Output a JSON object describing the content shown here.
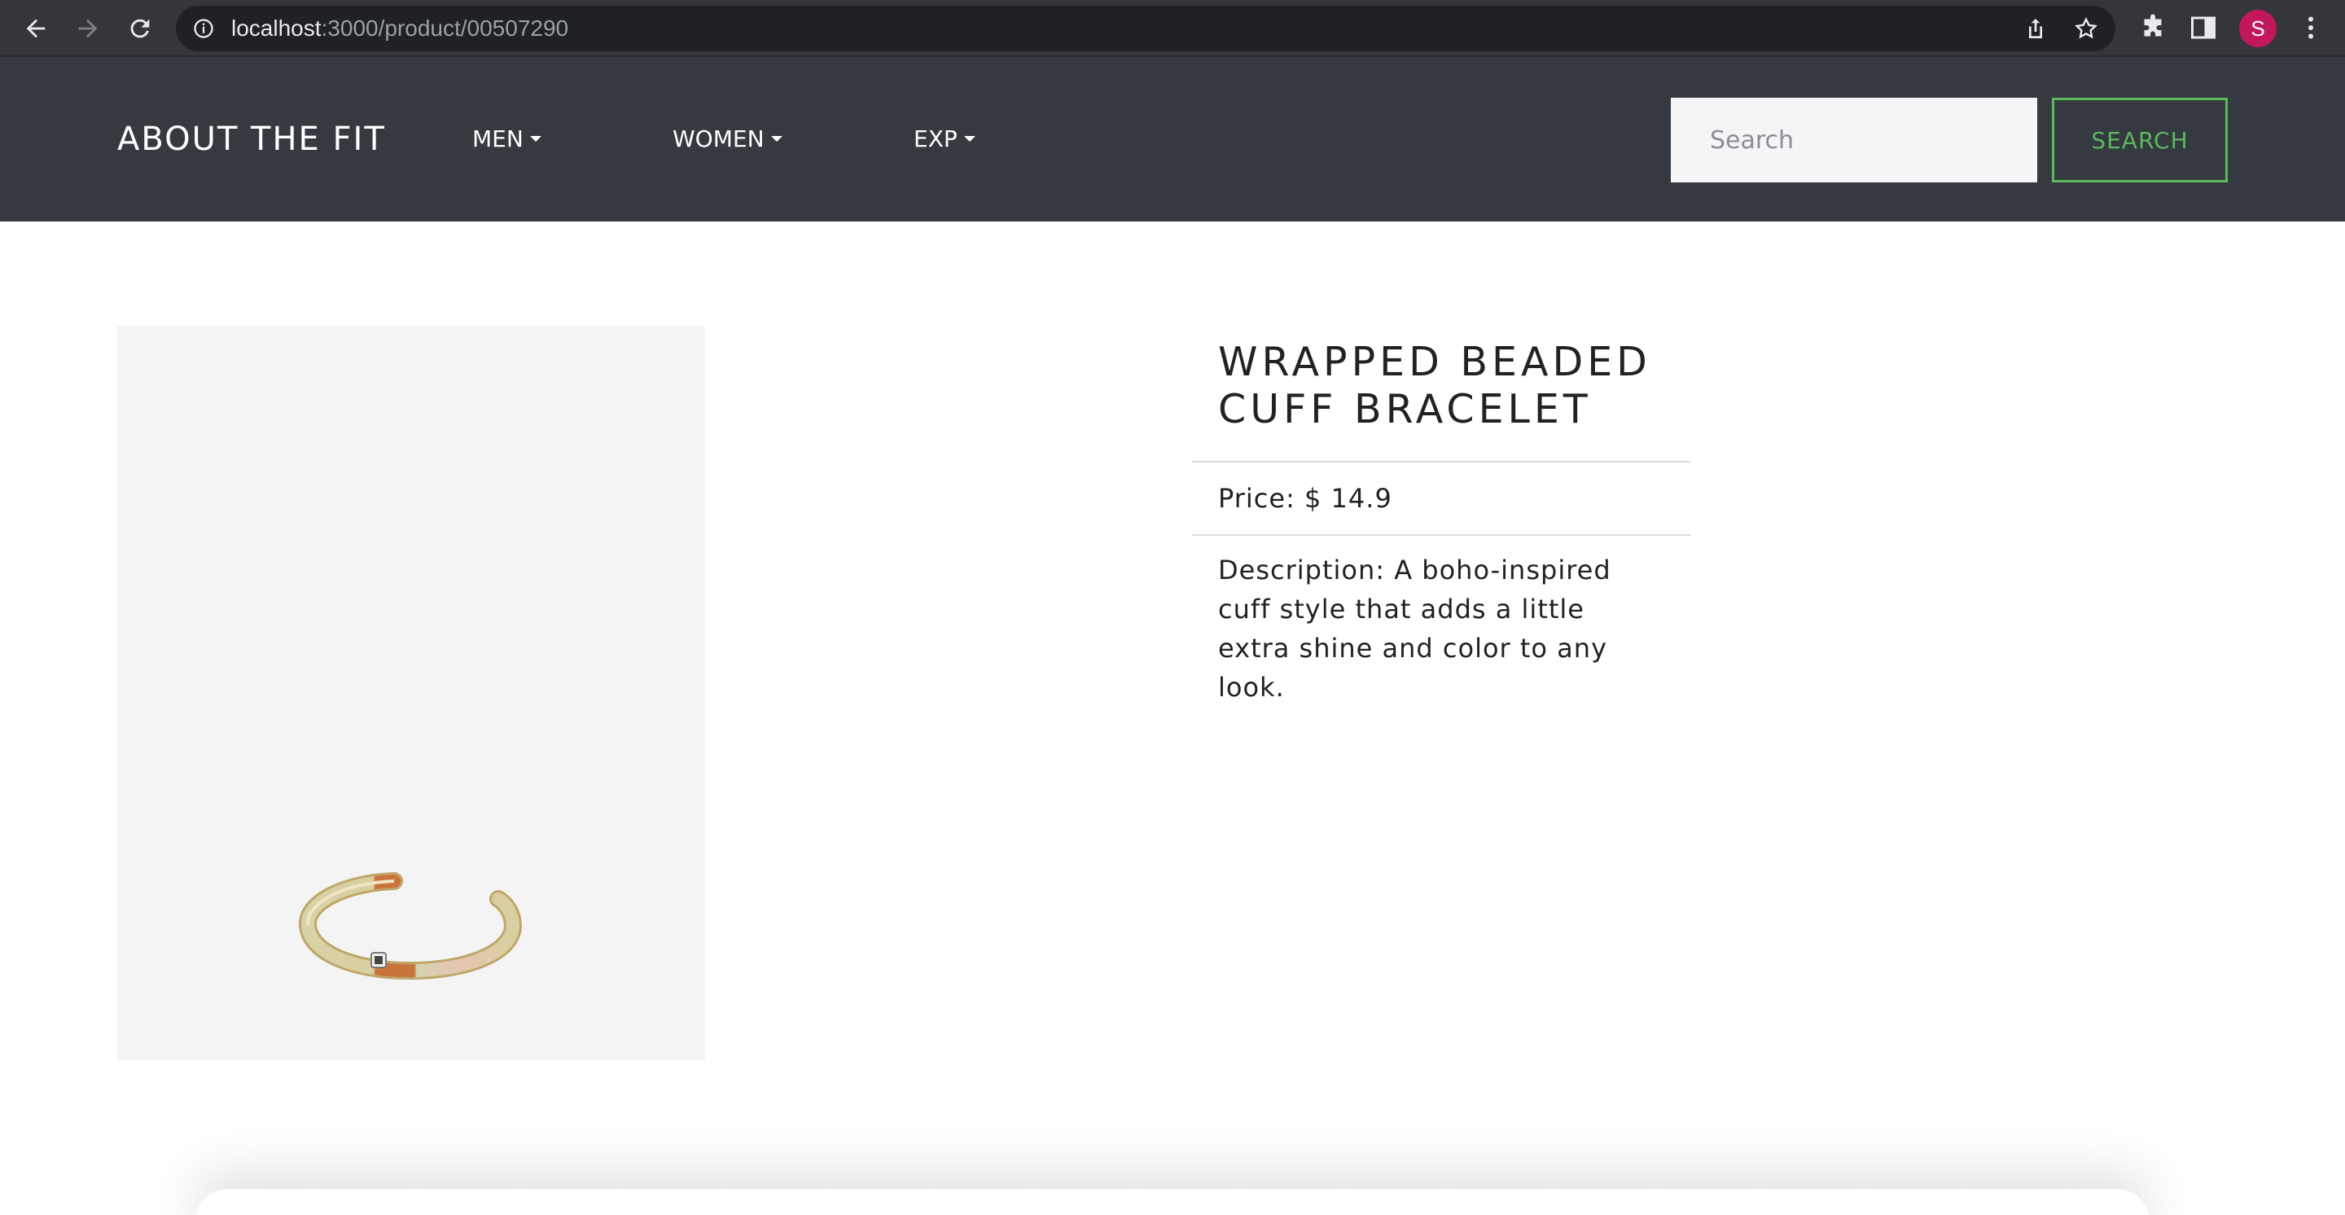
{
  "browser": {
    "url_host": "localhost",
    "url_path": ":3000/product/00507290",
    "profile_initial": "S",
    "profile_color": "#c2185b",
    "icons": [
      "back-icon",
      "forward-icon",
      "reload-icon",
      "info-icon",
      "share-icon",
      "star-icon",
      "puzzle-icon",
      "sidebar-icon",
      "kebab-menu-icon"
    ]
  },
  "navbar": {
    "brand": "ABOUT THE FIT",
    "links": [
      {
        "label": "MEN"
      },
      {
        "label": "WOMEN"
      },
      {
        "label": "EXP"
      }
    ],
    "search": {
      "placeholder": "Search",
      "value": "",
      "button_label": "SEARCH"
    },
    "background": "#343a40",
    "accent": "#5cb85c"
  },
  "product": {
    "title": "WRAPPED BEADED CUFF BRACELET",
    "price_text": "Price: $ 14.9",
    "description_text": "Description: A boho-inspired cuff style that adds a little extra shine and color to any look.",
    "image_alt_icon": "bracelet-image"
  }
}
